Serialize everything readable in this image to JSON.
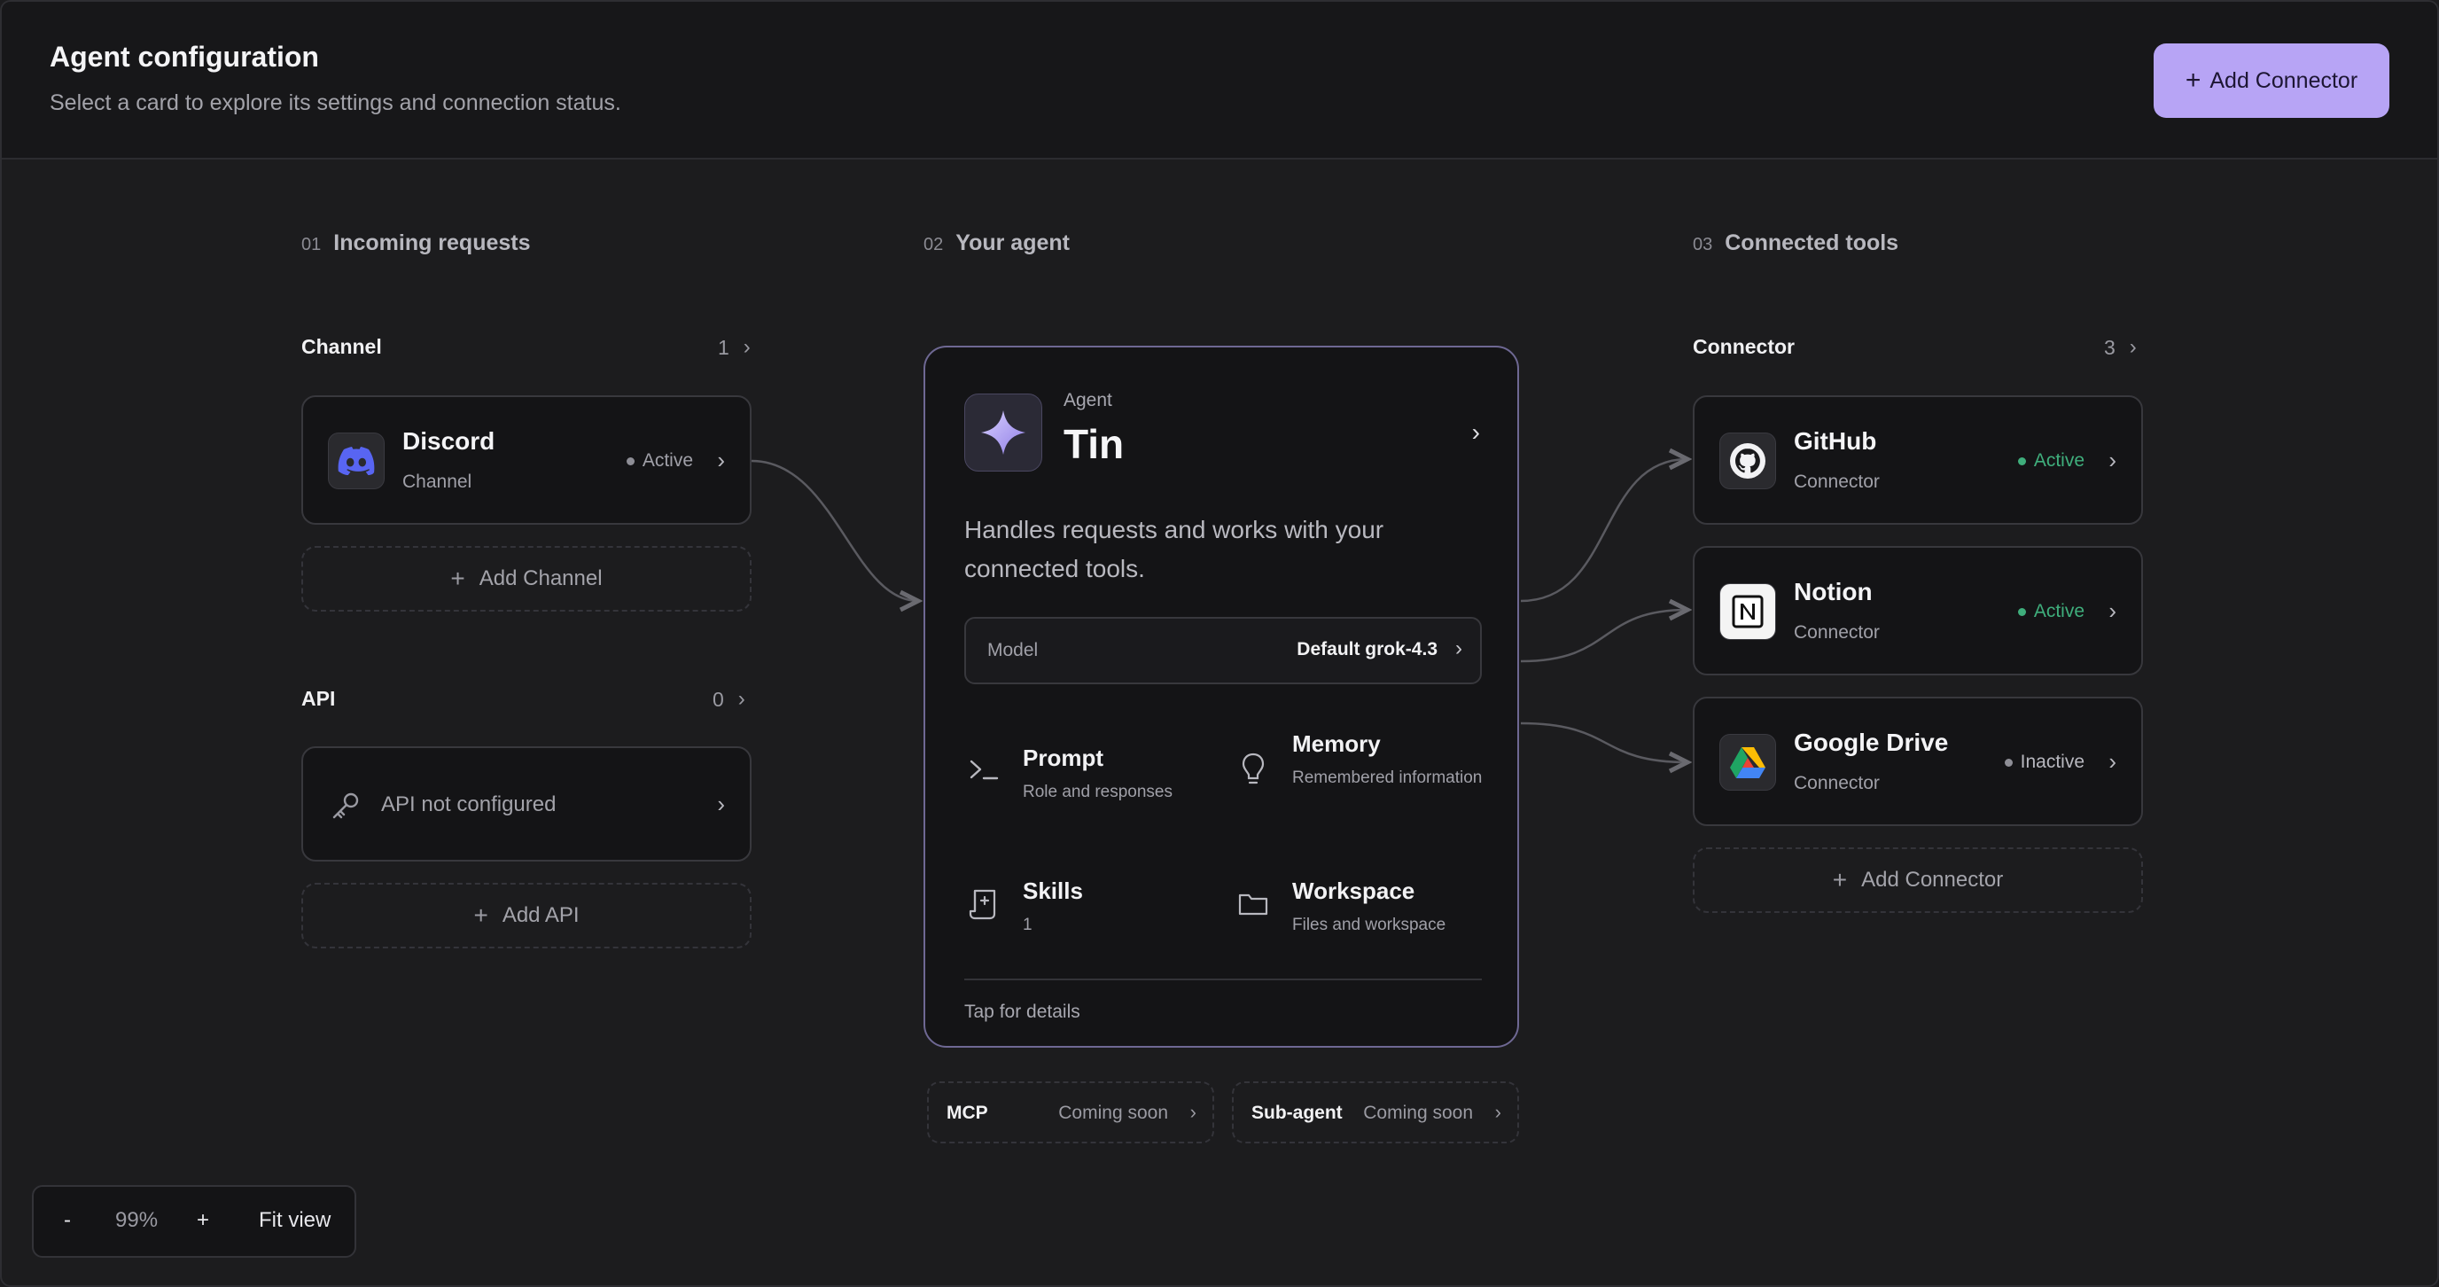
{
  "header": {
    "title": "Agent configuration",
    "subtitle": "Select a card to explore its settings and connection status.",
    "add_connector_label": "Add Connector"
  },
  "columns": [
    {
      "num": "01",
      "title": "Incoming requests"
    },
    {
      "num": "02",
      "title": "Your agent"
    },
    {
      "num": "03",
      "title": "Connected tools"
    }
  ],
  "incoming": {
    "channel": {
      "label": "Channel",
      "count": "1",
      "items": [
        {
          "name": "Discord",
          "type": "Channel",
          "status": "Active",
          "status_color": "#8e8e96",
          "icon": "discord-icon"
        }
      ],
      "add_label": "Add Channel"
    },
    "api": {
      "label": "API",
      "count": "0",
      "empty_text": "API not configured",
      "icon": "key-icon",
      "add_label": "Add API"
    }
  },
  "agent": {
    "kind": "Agent",
    "name": "Tin",
    "description": "Handles requests and works with your connected tools.",
    "model_label": "Model",
    "model_value": "Default grok-4.3",
    "features": [
      {
        "title": "Prompt",
        "sub": "Role and responses",
        "icon": "terminal-prompt-icon"
      },
      {
        "title": "Memory",
        "sub": "Remembered information",
        "icon": "lightbulb-icon"
      },
      {
        "title": "Skills",
        "sub": "1",
        "icon": "skills-scroll-icon"
      },
      {
        "title": "Workspace",
        "sub": "Files and workspace",
        "icon": "folder-icon"
      }
    ],
    "footer": "Tap for details",
    "extras": [
      {
        "label": "MCP",
        "status": "Coming soon"
      },
      {
        "label": "Sub-agent",
        "status": "Coming soon"
      }
    ]
  },
  "tools": {
    "label": "Connector",
    "count": "3",
    "items": [
      {
        "name": "GitHub",
        "type": "Connector",
        "status": "Active",
        "status_color": "#3fae7c",
        "icon": "github-icon"
      },
      {
        "name": "Notion",
        "type": "Connector",
        "status": "Active",
        "status_color": "#3fae7c",
        "icon": "notion-icon"
      },
      {
        "name": "Google Drive",
        "type": "Connector",
        "status": "Inactive",
        "status_color": "#8e8e96",
        "icon": "google-drive-icon"
      }
    ],
    "add_label": "Add Connector"
  },
  "zoom": {
    "minus": "-",
    "value": "99%",
    "plus": "+",
    "fit_label": "Fit view"
  },
  "colors": {
    "accent": "#b7a4f5",
    "agent_border": "#6e6893",
    "active_green": "#3fae7c"
  }
}
